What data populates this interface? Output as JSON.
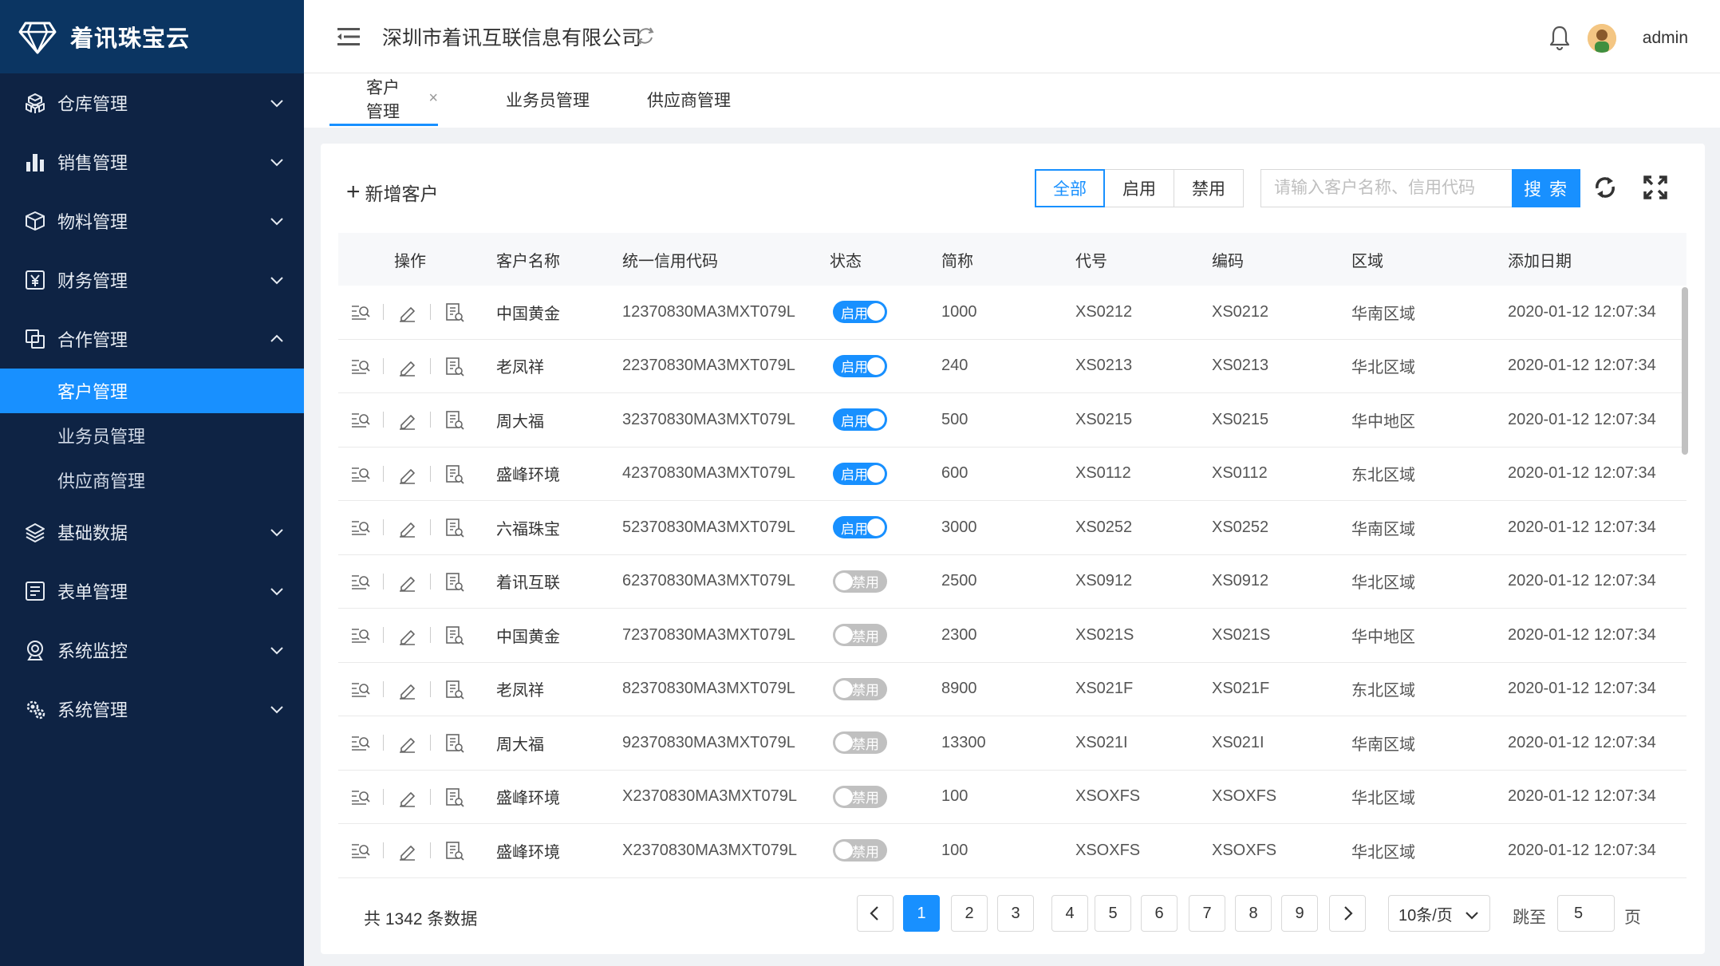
{
  "app": {
    "logo_text": "着讯珠宝云",
    "company": "深圳市着讯互联信息有限公司",
    "user": "admin"
  },
  "sidebar": {
    "items": [
      {
        "label": "仓库管理",
        "icon": "warehouse-icon"
      },
      {
        "label": "销售管理",
        "icon": "bar-chart-icon"
      },
      {
        "label": "物料管理",
        "icon": "box-icon"
      },
      {
        "label": "财务管理",
        "icon": "yen-icon"
      },
      {
        "label": "合作管理",
        "icon": "cooperation-icon",
        "expanded": true
      },
      {
        "label": "基础数据",
        "icon": "layers-icon"
      },
      {
        "label": "表单管理",
        "icon": "form-icon"
      },
      {
        "label": "系统监控",
        "icon": "monitor-icon"
      },
      {
        "label": "系统管理",
        "icon": "settings-icon"
      }
    ],
    "sub_items": [
      "客户管理",
      "业务员管理",
      "供应商管理"
    ],
    "active_sub": "客户管理"
  },
  "tabs": [
    "客户管理",
    "业务员管理",
    "供应商管理"
  ],
  "toolbar": {
    "add_label": "新增客户",
    "filter_all": "全部",
    "filter_enabled": "启用",
    "filter_disabled": "禁用",
    "search_placeholder": "请输入客户名称、信用代码",
    "search_label": "搜 索"
  },
  "table": {
    "headers": [
      "操作",
      "客户名称",
      "统一信用代码",
      "状态",
      "简称",
      "代号",
      "编码",
      "区域",
      "添加日期"
    ],
    "switch_on_label": "启用",
    "switch_off_label": "禁用",
    "rows": [
      {
        "name": "中国黄金",
        "code": "12370830MA3MXT079L",
        "status": true,
        "short": "1000",
        "alias": "XS0212",
        "num": "XS0212",
        "region": "华南区域",
        "date": "2020-01-12 12:07:34"
      },
      {
        "name": "老凤祥",
        "code": "22370830MA3MXT079L",
        "status": true,
        "short": "240",
        "alias": "XS0213",
        "num": "XS0213",
        "region": "华北区域",
        "date": "2020-01-12 12:07:34"
      },
      {
        "name": "周大福",
        "code": "32370830MA3MXT079L",
        "status": true,
        "short": "500",
        "alias": "XS0215",
        "num": "XS0215",
        "region": "华中地区",
        "date": "2020-01-12 12:07:34"
      },
      {
        "name": "盛峰环境",
        "code": "42370830MA3MXT079L",
        "status": true,
        "short": "600",
        "alias": "XS0112",
        "num": "XS0112",
        "region": "东北区域",
        "date": "2020-01-12 12:07:34"
      },
      {
        "name": "六福珠宝",
        "code": "52370830MA3MXT079L",
        "status": true,
        "short": "3000",
        "alias": "XS0252",
        "num": "XS0252",
        "region": "华南区域",
        "date": "2020-01-12 12:07:34"
      },
      {
        "name": "着讯互联",
        "code": "62370830MA3MXT079L",
        "status": false,
        "short": "2500",
        "alias": "XS0912",
        "num": "XS0912",
        "region": "华北区域",
        "date": "2020-01-12 12:07:34"
      },
      {
        "name": "中国黄金",
        "code": "72370830MA3MXT079L",
        "status": false,
        "short": "2300",
        "alias": "XS021S",
        "num": "XS021S",
        "region": "华中地区",
        "date": "2020-01-12 12:07:34"
      },
      {
        "name": "老凤祥",
        "code": "82370830MA3MXT079L",
        "status": false,
        "short": "8900",
        "alias": "XS021F",
        "num": "XS021F",
        "region": "东北区域",
        "date": "2020-01-12 12:07:34"
      },
      {
        "name": "周大福",
        "code": "92370830MA3MXT079L",
        "status": false,
        "short": "13300",
        "alias": "XS021I",
        "num": "XS021I",
        "region": "华南区域",
        "date": "2020-01-12 12:07:34"
      },
      {
        "name": "盛峰环境",
        "code": "X2370830MA3MXT079L",
        "status": false,
        "short": "100",
        "alias": "XSOXFS",
        "num": "XSOXFS",
        "region": "华北区域",
        "date": "2020-01-12 12:07:34"
      },
      {
        "name": "盛峰环境",
        "code": "X2370830MA3MXT079L",
        "status": false,
        "short": "100",
        "alias": "XSOXFS",
        "num": "XSOXFS",
        "region": "华北区域",
        "date": "2020-01-12 12:07:34"
      }
    ]
  },
  "pagination": {
    "total_text": "共 1342 条数据",
    "pages": [
      "1",
      "2",
      "3",
      "4",
      "5",
      "6",
      "7",
      "8",
      "9"
    ],
    "current": "1",
    "page_size": "10条/页",
    "jump_label": "跳至",
    "jump_value": "5",
    "page_label": "页"
  },
  "colors": {
    "sidebar_bg": "#0e2344",
    "logo_bg": "#0b3562",
    "accent": "#1890ff"
  }
}
